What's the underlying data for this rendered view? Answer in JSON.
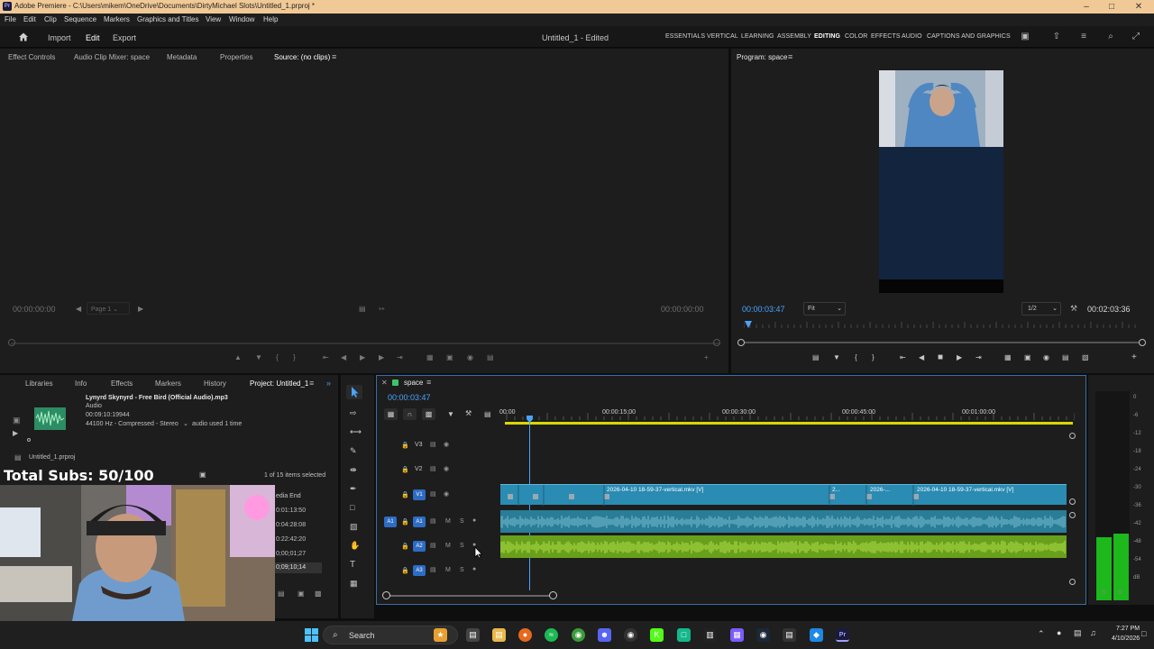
{
  "titlebar": {
    "app_icon": "Pr",
    "title": "Adobe Premiere - C:\\Users\\mikem\\OneDrive\\Documents\\DirtyMichael Slots\\Untitled_1.prproj *"
  },
  "menu": [
    "File",
    "Edit",
    "Clip",
    "Sequence",
    "Markers",
    "Graphics and Titles",
    "View",
    "Window",
    "Help"
  ],
  "header": {
    "home_icon": "home-icon",
    "import": "Import",
    "edit": "Edit",
    "export": "Export",
    "document": "Untitled_1 - Edited",
    "workspaces": [
      "ESSENTIALS",
      "VERTICAL",
      "LEARNING",
      "ASSEMBLY",
      "EDITING",
      "COLOR",
      "EFFECTS",
      "AUDIO",
      "CAPTIONS AND GRAPHICS"
    ],
    "active_workspace": "EDITING"
  },
  "source_panel": {
    "tabs": [
      "Effect Controls",
      "Audio Clip Mixer: space",
      "Metadata",
      "Properties",
      "Source: (no clips)"
    ],
    "active_tab": "Source: (no clips)",
    "timecode_left": "00:00:00:00",
    "page": "Page 1",
    "timecode_right": "00:00:00:00"
  },
  "program_panel": {
    "tab": "Program: space",
    "timecode": "00:00:03:47",
    "zoom": "Fit",
    "resolution": "1/2",
    "duration": "00:02:03:36"
  },
  "project_panel": {
    "tabs": [
      "Libraries",
      "Info",
      "Effects",
      "Markers",
      "History",
      "Project: Untitled_1"
    ],
    "active_tab": "Project: Untitled_1",
    "clip_name": "Lynyrd Skynyrd - Free Bird (Official Audio).mp3",
    "clip_type": "Audio",
    "clip_duration": "00:09:10:19944",
    "clip_format": "44100 Hz - Compressed - Stereo",
    "clip_usage": "audio used 1 time",
    "project_file": "Untitled_1.prproj",
    "selection": "1 of 15 items selected",
    "column_header": "edia End",
    "rows": [
      "0:01:13:50",
      "0:04:28:08",
      "0:22:42:20",
      "0;00;01;27",
      "0;09;10;14"
    ]
  },
  "overlay": {
    "subs_text": "Total Subs: 50/100"
  },
  "timeline": {
    "sequence": "space",
    "timecode": "00:00:03:47",
    "ruler": [
      "00:00",
      "00:00:15:00",
      "00:00:30:00",
      "00:00:45:00",
      "00:01:00:00"
    ],
    "tracks": [
      {
        "id": "V3",
        "type": "video"
      },
      {
        "id": "V2",
        "type": "video"
      },
      {
        "id": "V1",
        "type": "video",
        "source": "V1"
      },
      {
        "id": "A1",
        "type": "audio",
        "source": "A1"
      },
      {
        "id": "A2",
        "type": "audio"
      },
      {
        "id": "A3",
        "type": "audio"
      }
    ],
    "mute_label": "M",
    "solo_label": "S",
    "clips_v1": [
      "2026-04-10 18-59-37-vertical.mkv [V]",
      "2...",
      "2026-...",
      "2026-04-10 18-59-37-vertical.mkv [V]"
    ]
  },
  "audio_meter": {
    "scale": [
      "0",
      "-6",
      "-12",
      "-18",
      "-24",
      "-30",
      "-36",
      "-42",
      "-48",
      "-54",
      "dB"
    ],
    "level_left": 0.3,
    "level_right": 0.32,
    "channel_labels": [
      "S",
      "S"
    ]
  },
  "taskbar": {
    "search": "Search",
    "time": "7:27 PM",
    "date": "4/10/2026"
  },
  "colors": {
    "accent": "#4aa3ff",
    "video_clip": "#2a8bb3",
    "audio_clip": "#68a01c",
    "track_badge": "#2d6cc4"
  }
}
